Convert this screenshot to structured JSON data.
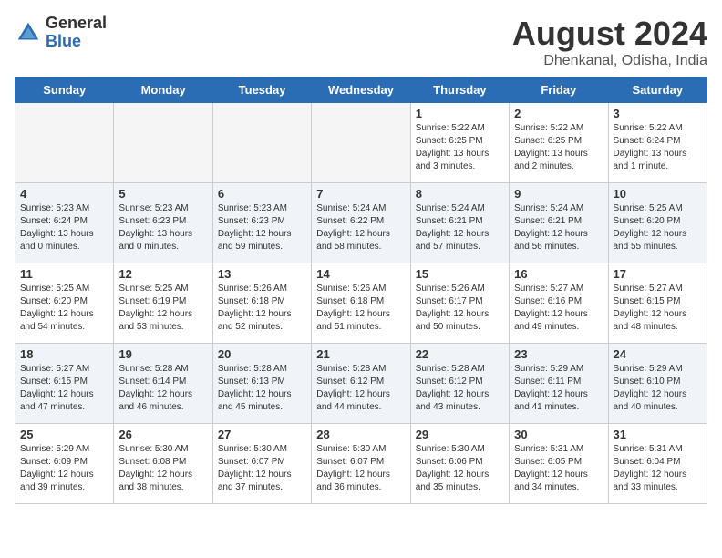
{
  "logo": {
    "general": "General",
    "blue": "Blue"
  },
  "title": {
    "month_year": "August 2024",
    "location": "Dhenkanal, Odisha, India"
  },
  "days_of_week": [
    "Sunday",
    "Monday",
    "Tuesday",
    "Wednesday",
    "Thursday",
    "Friday",
    "Saturday"
  ],
  "weeks": [
    [
      {
        "day": "",
        "empty": true
      },
      {
        "day": "",
        "empty": true
      },
      {
        "day": "",
        "empty": true
      },
      {
        "day": "",
        "empty": true
      },
      {
        "day": "1",
        "sunrise": "5:22 AM",
        "sunset": "6:25 PM",
        "daylight": "13 hours and 3 minutes."
      },
      {
        "day": "2",
        "sunrise": "5:22 AM",
        "sunset": "6:25 PM",
        "daylight": "13 hours and 2 minutes."
      },
      {
        "day": "3",
        "sunrise": "5:22 AM",
        "sunset": "6:24 PM",
        "daylight": "13 hours and 1 minute."
      }
    ],
    [
      {
        "day": "4",
        "sunrise": "5:23 AM",
        "sunset": "6:24 PM",
        "daylight": "13 hours and 0 minutes."
      },
      {
        "day": "5",
        "sunrise": "5:23 AM",
        "sunset": "6:23 PM",
        "daylight": "13 hours and 0 minutes."
      },
      {
        "day": "6",
        "sunrise": "5:23 AM",
        "sunset": "6:23 PM",
        "daylight": "12 hours and 59 minutes."
      },
      {
        "day": "7",
        "sunrise": "5:24 AM",
        "sunset": "6:22 PM",
        "daylight": "12 hours and 58 minutes."
      },
      {
        "day": "8",
        "sunrise": "5:24 AM",
        "sunset": "6:21 PM",
        "daylight": "12 hours and 57 minutes."
      },
      {
        "day": "9",
        "sunrise": "5:24 AM",
        "sunset": "6:21 PM",
        "daylight": "12 hours and 56 minutes."
      },
      {
        "day": "10",
        "sunrise": "5:25 AM",
        "sunset": "6:20 PM",
        "daylight": "12 hours and 55 minutes."
      }
    ],
    [
      {
        "day": "11",
        "sunrise": "5:25 AM",
        "sunset": "6:20 PM",
        "daylight": "12 hours and 54 minutes."
      },
      {
        "day": "12",
        "sunrise": "5:25 AM",
        "sunset": "6:19 PM",
        "daylight": "12 hours and 53 minutes."
      },
      {
        "day": "13",
        "sunrise": "5:26 AM",
        "sunset": "6:18 PM",
        "daylight": "12 hours and 52 minutes."
      },
      {
        "day": "14",
        "sunrise": "5:26 AM",
        "sunset": "6:18 PM",
        "daylight": "12 hours and 51 minutes."
      },
      {
        "day": "15",
        "sunrise": "5:26 AM",
        "sunset": "6:17 PM",
        "daylight": "12 hours and 50 minutes."
      },
      {
        "day": "16",
        "sunrise": "5:27 AM",
        "sunset": "6:16 PM",
        "daylight": "12 hours and 49 minutes."
      },
      {
        "day": "17",
        "sunrise": "5:27 AM",
        "sunset": "6:15 PM",
        "daylight": "12 hours and 48 minutes."
      }
    ],
    [
      {
        "day": "18",
        "sunrise": "5:27 AM",
        "sunset": "6:15 PM",
        "daylight": "12 hours and 47 minutes."
      },
      {
        "day": "19",
        "sunrise": "5:28 AM",
        "sunset": "6:14 PM",
        "daylight": "12 hours and 46 minutes."
      },
      {
        "day": "20",
        "sunrise": "5:28 AM",
        "sunset": "6:13 PM",
        "daylight": "12 hours and 45 minutes."
      },
      {
        "day": "21",
        "sunrise": "5:28 AM",
        "sunset": "6:12 PM",
        "daylight": "12 hours and 44 minutes."
      },
      {
        "day": "22",
        "sunrise": "5:28 AM",
        "sunset": "6:12 PM",
        "daylight": "12 hours and 43 minutes."
      },
      {
        "day": "23",
        "sunrise": "5:29 AM",
        "sunset": "6:11 PM",
        "daylight": "12 hours and 41 minutes."
      },
      {
        "day": "24",
        "sunrise": "5:29 AM",
        "sunset": "6:10 PM",
        "daylight": "12 hours and 40 minutes."
      }
    ],
    [
      {
        "day": "25",
        "sunrise": "5:29 AM",
        "sunset": "6:09 PM",
        "daylight": "12 hours and 39 minutes."
      },
      {
        "day": "26",
        "sunrise": "5:30 AM",
        "sunset": "6:08 PM",
        "daylight": "12 hours and 38 minutes."
      },
      {
        "day": "27",
        "sunrise": "5:30 AM",
        "sunset": "6:07 PM",
        "daylight": "12 hours and 37 minutes."
      },
      {
        "day": "28",
        "sunrise": "5:30 AM",
        "sunset": "6:07 PM",
        "daylight": "12 hours and 36 minutes."
      },
      {
        "day": "29",
        "sunrise": "5:30 AM",
        "sunset": "6:06 PM",
        "daylight": "12 hours and 35 minutes."
      },
      {
        "day": "30",
        "sunrise": "5:31 AM",
        "sunset": "6:05 PM",
        "daylight": "12 hours and 34 minutes."
      },
      {
        "day": "31",
        "sunrise": "5:31 AM",
        "sunset": "6:04 PM",
        "daylight": "12 hours and 33 minutes."
      }
    ]
  ]
}
